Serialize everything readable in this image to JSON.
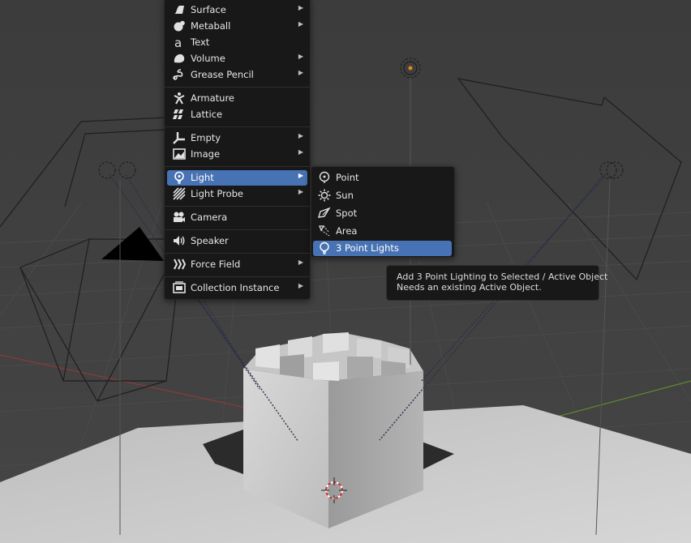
{
  "add_menu": {
    "items": [
      {
        "label": "Surface",
        "icon": "surface-icon",
        "submenu": true
      },
      {
        "label": "Metaball",
        "icon": "metaball-icon",
        "submenu": true
      },
      {
        "label": "Text",
        "icon": "text-icon",
        "submenu": false
      },
      {
        "label": "Volume",
        "icon": "volume-icon",
        "submenu": true
      },
      {
        "label": "Grease Pencil",
        "icon": "grease-pencil-icon",
        "submenu": true
      },
      {
        "label": "Armature",
        "icon": "armature-icon",
        "submenu": false
      },
      {
        "label": "Lattice",
        "icon": "lattice-icon",
        "submenu": false
      },
      {
        "label": "Empty",
        "icon": "empty-icon",
        "submenu": true
      },
      {
        "label": "Image",
        "icon": "image-icon",
        "submenu": true
      },
      {
        "label": "Light",
        "icon": "light-icon",
        "submenu": true,
        "active": true
      },
      {
        "label": "Light Probe",
        "icon": "light-probe-icon",
        "submenu": true
      },
      {
        "label": "Camera",
        "icon": "camera-icon",
        "submenu": false
      },
      {
        "label": "Speaker",
        "icon": "speaker-icon",
        "submenu": false
      },
      {
        "label": "Force Field",
        "icon": "force-field-icon",
        "submenu": true
      },
      {
        "label": "Collection Instance",
        "icon": "collection-instance-icon",
        "submenu": true
      }
    ],
    "submenu_arrow": "▶"
  },
  "light_submenu": {
    "items": [
      {
        "label": "Point",
        "icon": "point-light-icon"
      },
      {
        "label": "Sun",
        "icon": "sun-light-icon"
      },
      {
        "label": "Spot",
        "icon": "spot-light-icon"
      },
      {
        "label": "Area",
        "icon": "area-light-icon"
      },
      {
        "label": "3 Point Lights",
        "icon": "three-point-lights-icon",
        "active": true
      }
    ]
  },
  "tooltip": {
    "line1": "Add 3 Point Lighting to Selected / Active Object",
    "line2": "Needs an existing Active Object."
  },
  "colors": {
    "menu_bg": "#181818",
    "highlight": "#4772b3",
    "viewport_bg": "#3d3d3d",
    "x_axis": "#8a3a3a",
    "y_axis": "#5f8a2e"
  }
}
